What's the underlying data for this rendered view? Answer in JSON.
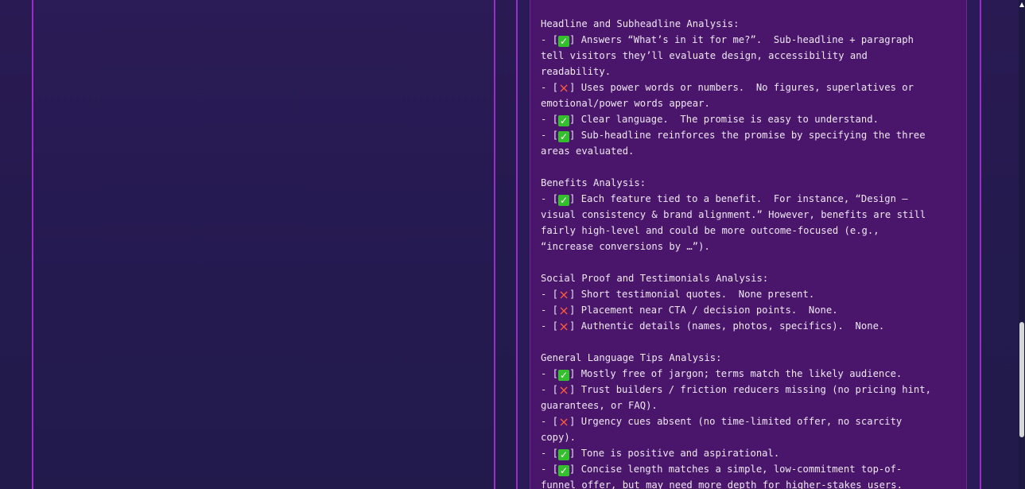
{
  "report": {
    "sections": [
      {
        "heading": "Headline and Subheadline Analysis:",
        "items": [
          {
            "status": "check",
            "lines": [
              "] Answers “What’s in it for me?”.  Sub-headline + paragraph",
              "tell visitors they’ll evaluate design, accessibility and",
              "readability."
            ]
          },
          {
            "status": "cross",
            "lines": [
              "] Uses power words or numbers.  No figures, superlatives or",
              "emotional/power words appear."
            ]
          },
          {
            "status": "check",
            "lines": [
              "] Clear language.  The promise is easy to understand."
            ]
          },
          {
            "status": "check",
            "lines": [
              "] Sub-headline reinforces the promise by specifying the three",
              "areas evaluated."
            ]
          }
        ]
      },
      {
        "heading": "Benefits Analysis:",
        "items": [
          {
            "status": "check",
            "lines": [
              "] Each feature tied to a benefit.  For instance, “Design –",
              "visual consistency & brand alignment.” However, benefits are still",
              "fairly high-level and could be more outcome-focused (e.g.,",
              "“increase conversions by …”)."
            ]
          }
        ]
      },
      {
        "heading": "Social Proof and Testimonials Analysis:",
        "items": [
          {
            "status": "cross",
            "lines": [
              "] Short testimonial quotes.  None present."
            ]
          },
          {
            "status": "cross",
            "lines": [
              "] Placement near CTA / decision points.  None."
            ]
          },
          {
            "status": "cross",
            "lines": [
              "] Authentic details (names, photos, specifics).  None."
            ]
          }
        ]
      },
      {
        "heading": "General Language Tips Analysis:",
        "items": [
          {
            "status": "check",
            "lines": [
              "] Mostly free of jargon; terms match the likely audience."
            ]
          },
          {
            "status": "cross",
            "lines": [
              "] Trust builders / friction reducers missing (no pricing hint,",
              "guarantees, or FAQ)."
            ]
          },
          {
            "status": "cross",
            "lines": [
              "] Urgency cues absent (no time-limited offer, no scarcity",
              "copy)."
            ]
          },
          {
            "status": "check",
            "lines": [
              "] Tone is positive and aspirational."
            ]
          },
          {
            "status": "check",
            "lines": [
              "] Concise length matches a simple, low-commitment top-of-",
              "funnel offer, but may need more depth for higher-stakes users."
            ]
          }
        ]
      }
    ],
    "list_prefix": "- [",
    "check_symbol": "✓",
    "cross_symbol": "×"
  },
  "colors": {
    "background": "#241a4e",
    "panel_border": "#9d2bc9",
    "report_background": "#4a166c",
    "text": "#eee7f4",
    "check": "#35bf2f",
    "cross": "#ff5a3d",
    "scroll_thumb": "#d7d7d7"
  },
  "icons": {
    "check": "check-mark-icon",
    "cross": "cross-mark-icon",
    "scroll_up": "arrow-up-icon"
  }
}
